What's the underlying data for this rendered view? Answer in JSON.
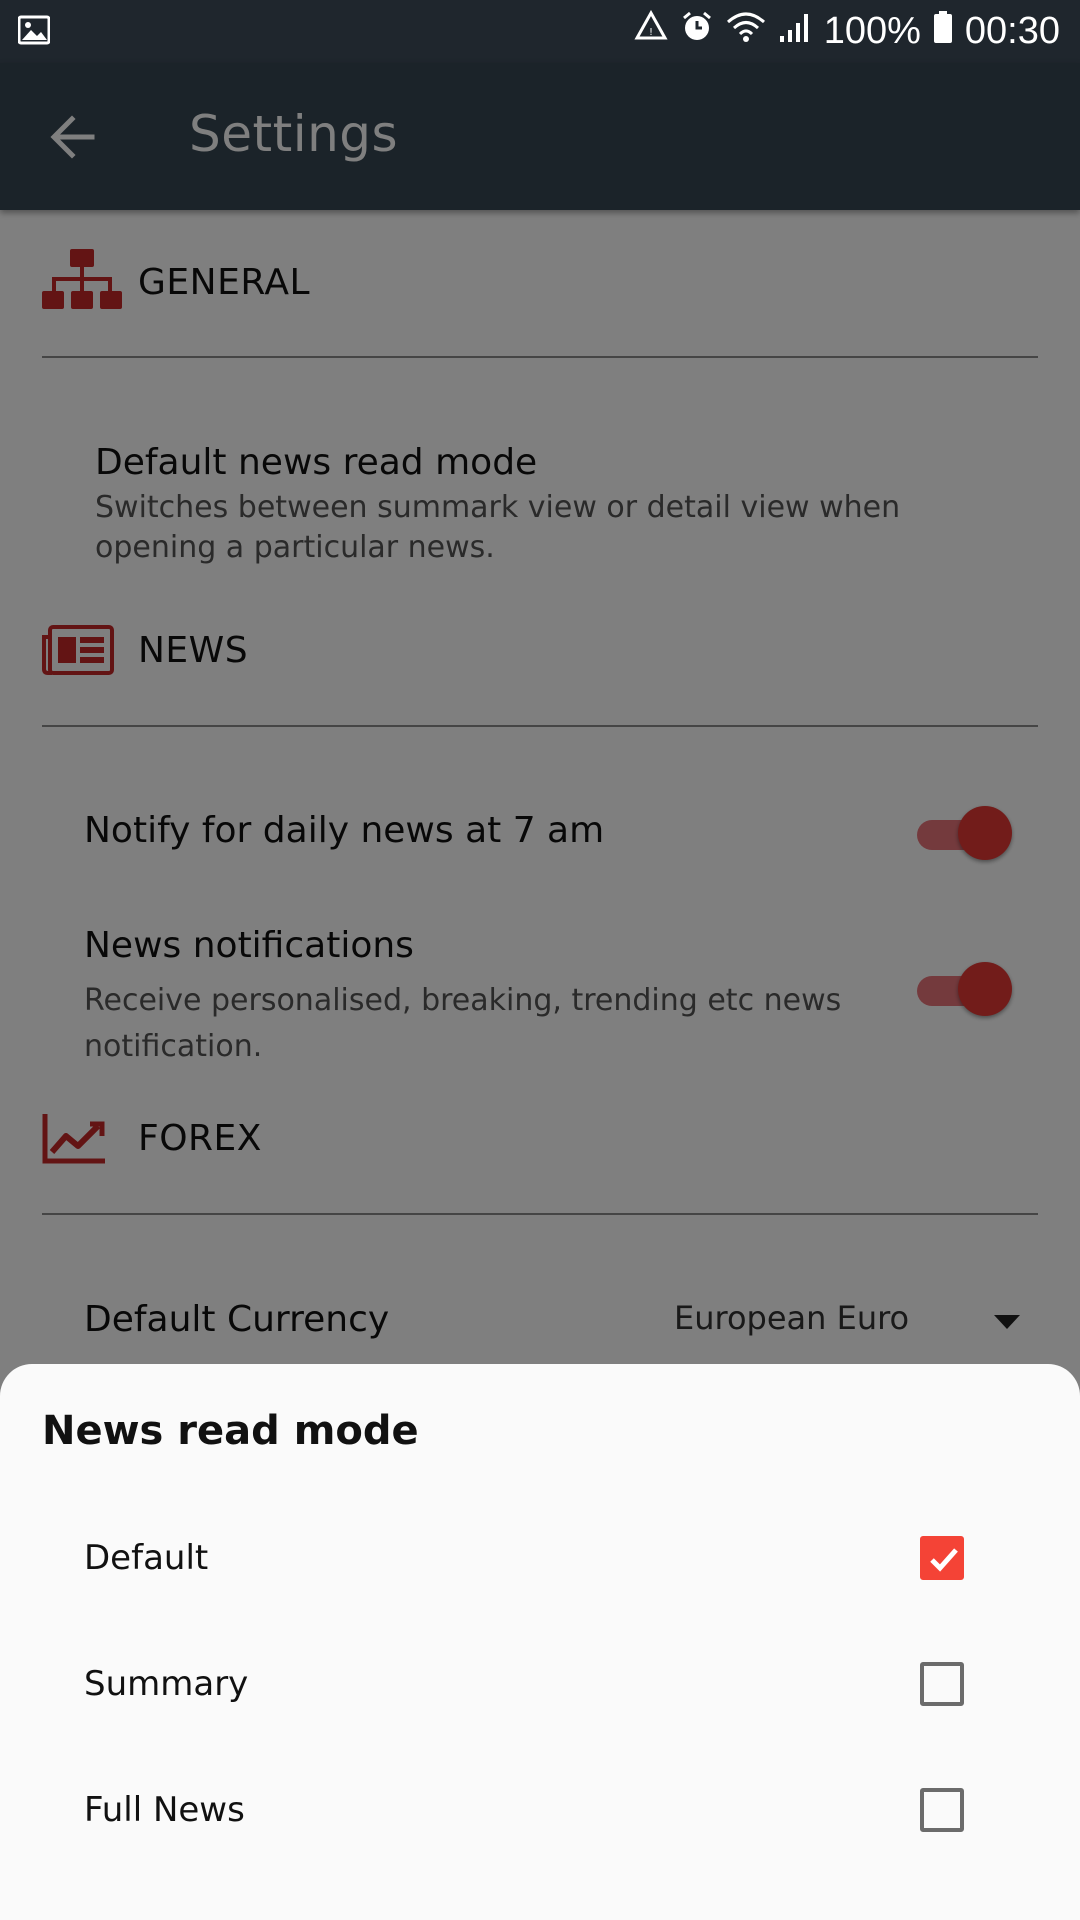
{
  "status_bar": {
    "battery": "100%",
    "time": "00:30",
    "icons": [
      "image-icon",
      "drive-icon",
      "alarm-icon",
      "wifi-icon",
      "signal-icon",
      "battery-icon"
    ]
  },
  "toolbar": {
    "title": "Settings",
    "back_icon": "arrow-left-icon"
  },
  "sections": {
    "general": {
      "label": "GENERAL",
      "icon": "sitemap-icon",
      "items": [
        {
          "title": "Default news read mode",
          "subtitle": "Switches between summark view or detail view when opening a particular news."
        }
      ]
    },
    "news": {
      "label": "NEWS",
      "icon": "newspaper-icon",
      "items": [
        {
          "title": "Notify for daily news at 7 am",
          "toggle_on": true
        },
        {
          "title": "News notifications",
          "subtitle": "Receive personalised, breaking, trending etc news notification.",
          "toggle_on": true
        }
      ]
    },
    "forex": {
      "label": "FOREX",
      "icon": "chart-line-icon",
      "items": [
        {
          "title": "Default Currency",
          "value": "European Euro"
        }
      ]
    }
  },
  "sheet": {
    "title": "News read mode",
    "options": [
      {
        "label": "Default",
        "checked": true
      },
      {
        "label": "Summary",
        "checked": false
      },
      {
        "label": "Full News",
        "checked": false
      }
    ]
  },
  "colors": {
    "accent": "#f44336",
    "toolbar": "#374752",
    "statusbar": "#1f262d",
    "icon_red": "#c62828"
  }
}
